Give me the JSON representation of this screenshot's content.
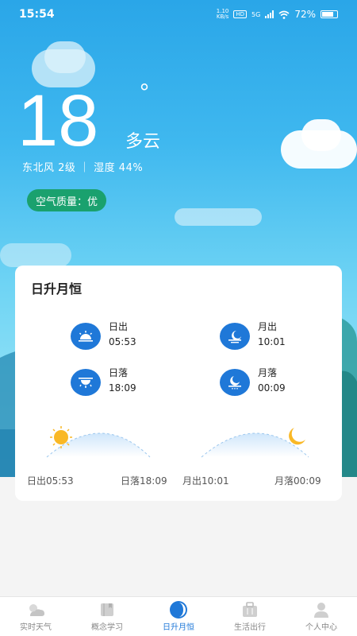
{
  "status_bar": {
    "time": "15:54",
    "net_speed_value": "1.10",
    "net_speed_unit": "KB/s",
    "hd": "HD",
    "network": "5G",
    "battery": "72%"
  },
  "weather": {
    "temperature": "18",
    "degree_symbol": "°",
    "condition": "多云",
    "wind_humidity": "东北风 2级 ｜ 湿度 44%",
    "air_quality": "空气质量：优"
  },
  "sun_moon": {
    "title": "日升月恒",
    "items": [
      {
        "label": "日出",
        "value": "05:53",
        "icon": "sunrise-icon"
      },
      {
        "label": "月出",
        "value": "10:01",
        "icon": "moonrise-icon"
      },
      {
        "label": "日落",
        "value": "18:09",
        "icon": "sunset-icon"
      },
      {
        "label": "月落",
        "value": "00:09",
        "icon": "moonset-icon"
      }
    ],
    "sun_arc": {
      "start_label": "日出05:53",
      "end_label": "日落18:09"
    },
    "moon_arc": {
      "start_label": "月出10:01",
      "end_label": "月落00:09"
    }
  },
  "nav": {
    "items": [
      {
        "label": "实时天气",
        "icon": "weather-icon"
      },
      {
        "label": "概念学习",
        "icon": "book-icon"
      },
      {
        "label": "日升月恒",
        "icon": "half-moon-icon"
      },
      {
        "label": "生活出行",
        "icon": "bag-icon"
      },
      {
        "label": "个人中心",
        "icon": "person-icon"
      }
    ],
    "active_index": 2
  },
  "colors": {
    "accent": "#1f78d8",
    "aqi_badge": "#1aa16e",
    "sky_top": "#2aa6e8",
    "sky_bottom": "#a8ebf8"
  }
}
